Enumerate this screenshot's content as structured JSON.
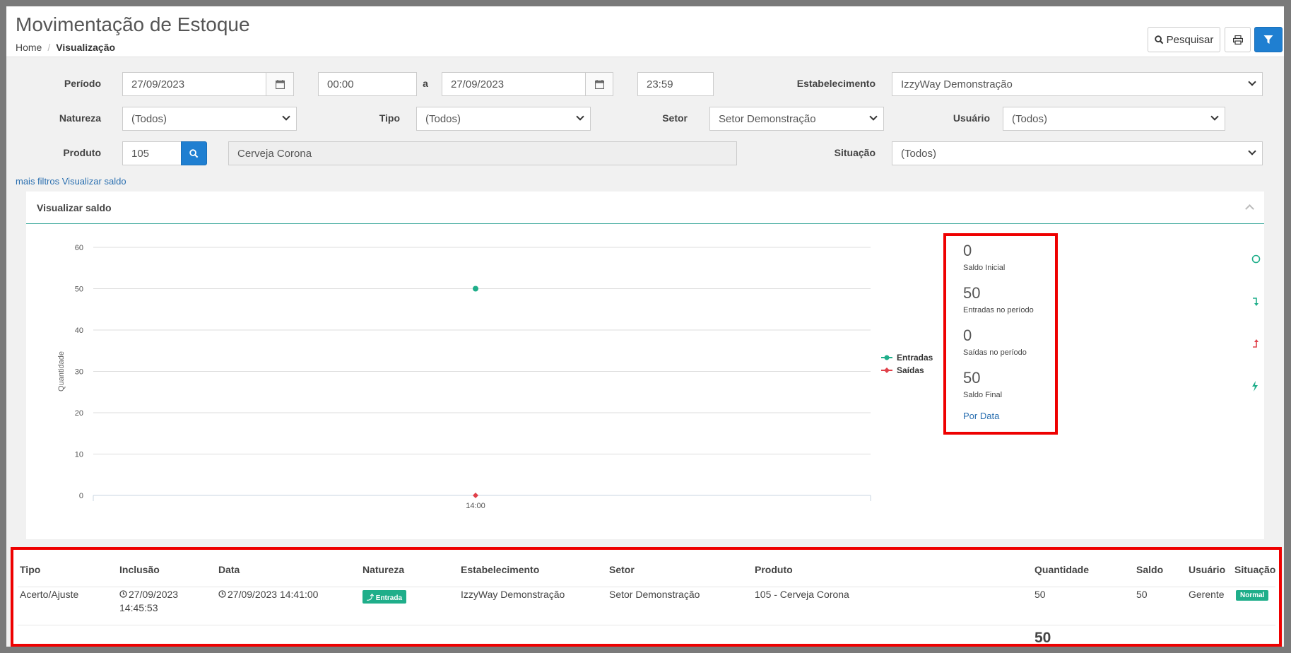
{
  "header": {
    "title": "Movimentação de Estoque",
    "breadcrumb": [
      "Home",
      "Visualização"
    ],
    "search_label": "Pesquisar"
  },
  "filters": {
    "periodo_label": "Período",
    "date_start": "27/09/2023",
    "time_start": "00:00",
    "a_label": "a",
    "date_end": "27/09/2023",
    "time_end": "23:59",
    "estabelecimento_label": "Estabelecimento",
    "estabelecimento_value": "IzzyWay Demonstração",
    "natureza_label": "Natureza",
    "natureza_value": "(Todos)",
    "tipo_label": "Tipo",
    "tipo_value": "(Todos)",
    "setor_label": "Setor",
    "setor_value": "Setor Demonstração",
    "usuario_label": "Usuário",
    "usuario_value": "(Todos)",
    "produto_label": "Produto",
    "produto_code": "105",
    "produto_name": "Cerveja Corona",
    "situacao_label": "Situação",
    "situacao_value": "(Todos)",
    "mais_filtros": "mais filtros",
    "visualizar_saldo": "Visualizar saldo"
  },
  "panel": {
    "title": "Visualizar saldo"
  },
  "stats": {
    "saldo_inicial": "0",
    "saldo_inicial_label": "Saldo Inicial",
    "entradas": "50",
    "entradas_label": "Entradas no período",
    "saidas": "0",
    "saidas_label": "Saídas no período",
    "saldo_final": "50",
    "saldo_final_label": "Saldo Final",
    "por_data": "Por Data"
  },
  "chart_data": {
    "type": "line",
    "x": [
      "14:00"
    ],
    "series": [
      {
        "name": "Entradas",
        "values": [
          50
        ],
        "color": "#1fae8a"
      },
      {
        "name": "Saídas",
        "values": [
          0
        ],
        "color": "#e0404a"
      }
    ],
    "ylabel": "Quantidade",
    "ylim": [
      0,
      60
    ],
    "yticks": [
      0,
      10,
      20,
      30,
      40,
      50,
      60
    ],
    "grid": true,
    "legend": "right"
  },
  "table": {
    "headers": [
      "Tipo",
      "Inclusão",
      "Data",
      "Natureza",
      "Estabelecimento",
      "Setor",
      "Produto",
      "Quantidade",
      "Saldo",
      "Usuário",
      "Situação"
    ],
    "rows": [
      {
        "tipo": "Acerto/Ajuste",
        "inclusao_date": "27/09/2023",
        "inclusao_time": "14:45:53",
        "data": "27/09/2023 14:41:00",
        "natureza": "Entrada",
        "estabelecimento": "IzzyWay Demonstração",
        "setor": "Setor Demonstração",
        "produto": "105 - Cerveja Corona",
        "quantidade": "50",
        "saldo": "50",
        "usuario": "Gerente",
        "situacao": "Normal"
      }
    ],
    "total_quantidade": "50"
  }
}
